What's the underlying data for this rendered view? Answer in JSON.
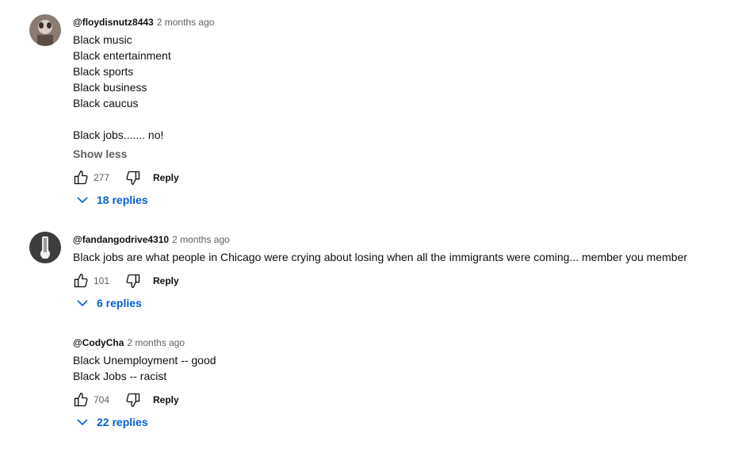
{
  "colors": {
    "link": "#065fd4",
    "muted": "#606060",
    "text": "#0f0f0f"
  },
  "comments": [
    {
      "author": "@floydisnutz8443",
      "time": "2 months ago",
      "lines": [
        "Black music",
        "Black entertainment",
        "Black sports",
        "Black business",
        "Black caucus",
        "",
        "Black jobs....... no!"
      ],
      "show_less": "Show less",
      "likes": "277",
      "reply": "Reply",
      "replies": "18 replies"
    },
    {
      "author": "@fandangodrive4310",
      "time": "2 months ago",
      "lines": [
        "Black jobs are what people in Chicago were crying about losing when all the immigrants were coming... member you member"
      ],
      "likes": "101",
      "reply": "Reply",
      "replies": "6 replies"
    },
    {
      "author": "@CodyCha",
      "time": "2 months ago",
      "lines": [
        "Black Unemployment -- good",
        "Black Jobs -- racist"
      ],
      "likes": "704",
      "reply": "Reply",
      "replies": "22 replies"
    }
  ]
}
